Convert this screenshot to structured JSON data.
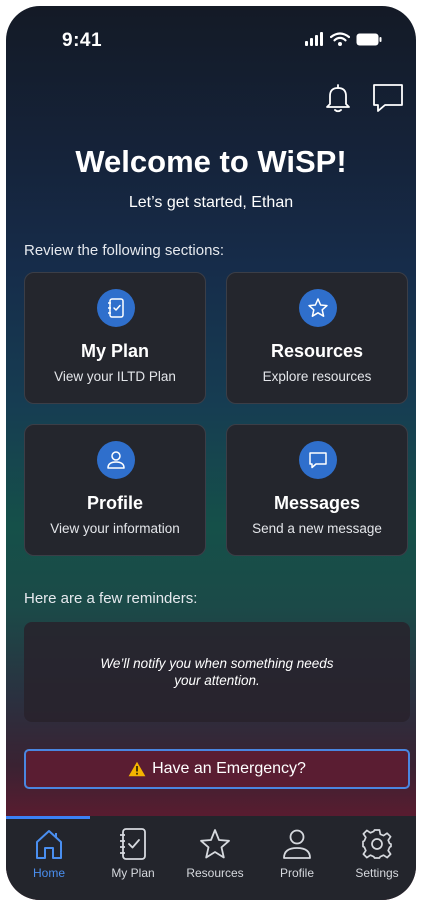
{
  "status_bar": {
    "time": "9:41"
  },
  "header": {
    "title": "Welcome to WiSP!",
    "subtitle": "Let’s get started, Ethan"
  },
  "sections": {
    "label": "Review the following sections:",
    "cards": [
      {
        "title": "My Plan",
        "subtitle": "View your ILTD Plan",
        "icon": "plan-icon"
      },
      {
        "title": "Resources",
        "subtitle": "Explore resources",
        "icon": "star-icon"
      },
      {
        "title": "Profile",
        "subtitle": "View your information",
        "icon": "person-icon"
      },
      {
        "title": "Messages",
        "subtitle": "Send a new message",
        "icon": "message-icon"
      }
    ]
  },
  "reminders": {
    "label": "Here are a few reminders:",
    "empty_text": "We’ll notify you when something needs your attention."
  },
  "emergency": {
    "label": "Have an Emergency?"
  },
  "tab_bar": {
    "active": "Home",
    "tabs": [
      {
        "label": "Home",
        "icon": "home-icon"
      },
      {
        "label": "My Plan",
        "icon": "plan-icon"
      },
      {
        "label": "Resources",
        "icon": "star-icon"
      },
      {
        "label": "Profile",
        "icon": "person-icon"
      },
      {
        "label": "Settings",
        "icon": "gear-icon"
      }
    ]
  },
  "colors": {
    "accent": "#2f6fcc",
    "active_tab": "#4a8ff0",
    "emergency_bg": "#5a1d32",
    "emergency_border": "#4a86e0",
    "warning": "#f5b400"
  }
}
